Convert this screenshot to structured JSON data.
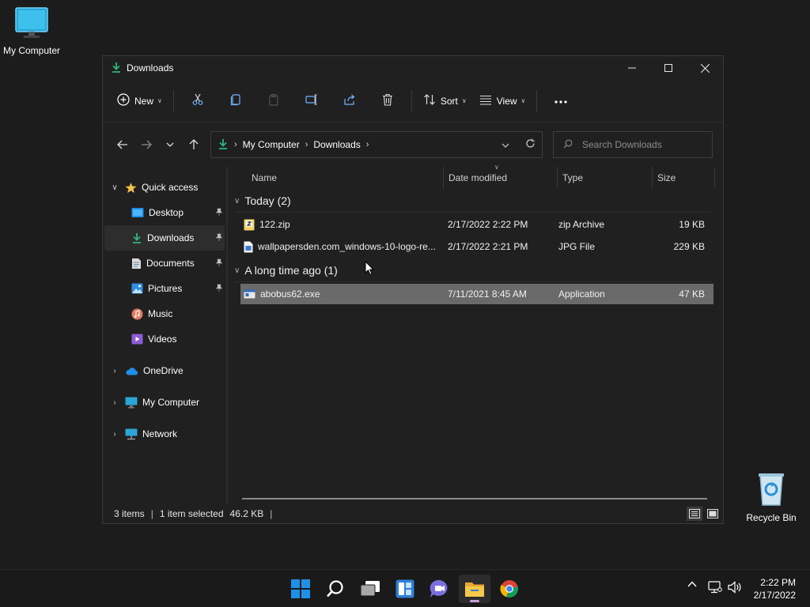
{
  "desktop": {
    "icons": [
      {
        "label": "My Computer"
      },
      {
        "label": "Recycle Bin"
      }
    ]
  },
  "window": {
    "title": "Downloads",
    "toolbar": {
      "new_label": "New",
      "sort_label": "Sort",
      "view_label": "View"
    },
    "address": {
      "crumbs": [
        "My Computer",
        "Downloads"
      ]
    },
    "search": {
      "placeholder": "Search Downloads"
    },
    "sidebar": {
      "quick_access_label": "Quick access",
      "pinned": [
        {
          "label": "Desktop",
          "icon": "desktop-icon",
          "pinned": true
        },
        {
          "label": "Downloads",
          "icon": "downloads-icon",
          "pinned": true,
          "selected": true
        },
        {
          "label": "Documents",
          "icon": "documents-icon",
          "pinned": true
        },
        {
          "label": "Pictures",
          "icon": "pictures-icon",
          "pinned": true
        },
        {
          "label": "Music",
          "icon": "music-icon",
          "pinned": false
        },
        {
          "label": "Videos",
          "icon": "videos-icon",
          "pinned": false
        }
      ],
      "roots": [
        {
          "label": "OneDrive",
          "icon": "onedrive-icon"
        },
        {
          "label": "My Computer",
          "icon": "computer-icon"
        },
        {
          "label": "Network",
          "icon": "network-icon"
        }
      ]
    },
    "columns": {
      "name": "Name",
      "date": "Date modified",
      "type": "Type",
      "size": "Size"
    },
    "groups": [
      {
        "title": "Today (2)",
        "files": [
          {
            "name": "122.zip",
            "date": "2/17/2022 2:22 PM",
            "type": "zip Archive",
            "size": "19 KB",
            "icon": "zip-file-icon"
          },
          {
            "name": "wallpapersden.com_windows-10-logo-re...",
            "date": "2/17/2022 2:21 PM",
            "type": "JPG File",
            "size": "229 KB",
            "icon": "image-file-icon"
          }
        ]
      },
      {
        "title": "A long time ago (1)",
        "files": [
          {
            "name": "abobus62.exe",
            "date": "7/11/2021 8:45 AM",
            "type": "Application",
            "size": "47 KB",
            "icon": "exe-file-icon",
            "selected": true
          }
        ]
      }
    ],
    "status": {
      "items": "3 items",
      "selection": "1 item selected",
      "size": "46.2 KB"
    }
  },
  "taskbar": {
    "clock_time": "2:22 PM",
    "clock_date": "2/17/2022",
    "apps": [
      "start",
      "search",
      "task-view",
      "widgets",
      "chat",
      "file-explorer",
      "chrome"
    ],
    "active_app": "file-explorer"
  },
  "colors": {
    "accent_download": "#2fb67c",
    "folder_yellow": "#f3c14b",
    "selection_bg": "#6a6a6a",
    "start_blue": "#1e90e8"
  }
}
